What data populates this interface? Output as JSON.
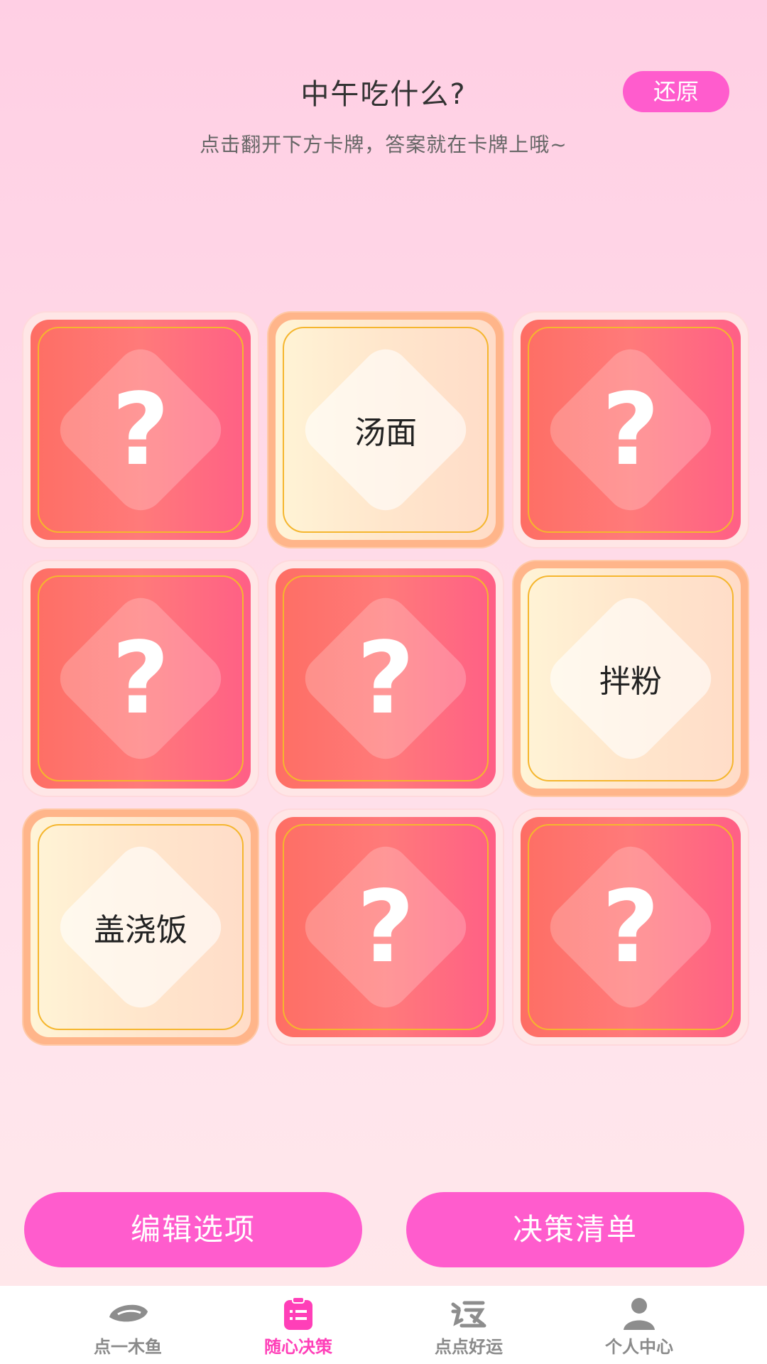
{
  "header": {
    "title": "中午吃什么?",
    "subtitle": "点击翻开下方卡牌，答案就在卡牌上哦~",
    "reset_label": "还原"
  },
  "cards": [
    {
      "state": "hidden",
      "label": "?"
    },
    {
      "state": "revealed",
      "label": "汤面"
    },
    {
      "state": "hidden",
      "label": "?"
    },
    {
      "state": "hidden",
      "label": "?"
    },
    {
      "state": "hidden",
      "label": "?"
    },
    {
      "state": "revealed",
      "label": "拌粉"
    },
    {
      "state": "revealed",
      "label": "盖浇饭"
    },
    {
      "state": "hidden",
      "label": "?"
    },
    {
      "state": "hidden",
      "label": "?"
    }
  ],
  "actions": {
    "edit_label": "编辑选项",
    "list_label": "决策清单"
  },
  "tabbar": {
    "items": [
      {
        "label": "点一木鱼",
        "icon": "wooden-fish-icon",
        "active": false
      },
      {
        "label": "随心决策",
        "icon": "clipboard-list-icon",
        "active": true
      },
      {
        "label": "点点好运",
        "icon": "luck-character-icon",
        "active": false
      },
      {
        "label": "个人中心",
        "icon": "person-icon",
        "active": false
      }
    ]
  },
  "colors": {
    "accent": "#ff5ccd",
    "active_tab": "#ff3fb8",
    "card_front": "#fe6e64",
    "card_back": "#fff4d6"
  }
}
